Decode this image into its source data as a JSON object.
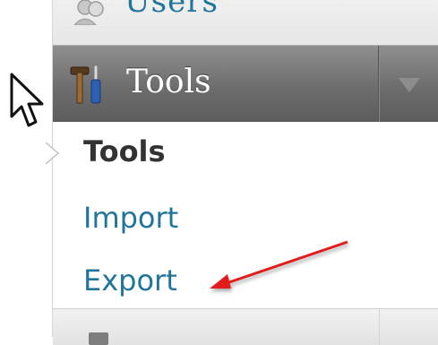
{
  "menu": {
    "users_label": "Users",
    "tools_label": "Tools",
    "submenu": {
      "current": "Tools",
      "import": "Import",
      "export": "Export"
    }
  },
  "colors": {
    "link": "#21759b",
    "header_gradient_top": "#8f8f8f",
    "header_gradient_bottom": "#5c5c5c",
    "annotation_arrow": "#e11d1d"
  },
  "icons": {
    "users": "users-icon",
    "tools": "tools-icon",
    "toggle": "triangle-down-icon",
    "cursor": "mouse-pointer-icon",
    "annotation": "red-arrow-icon"
  }
}
